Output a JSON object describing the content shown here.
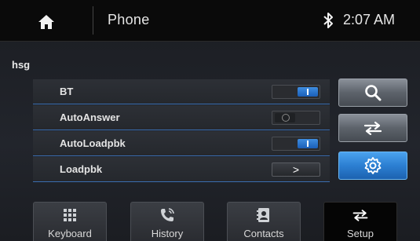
{
  "header": {
    "home_icon": "home-icon",
    "title": "Phone",
    "status_icon": "bluetooth-icon",
    "time": "2:07 AM"
  },
  "device": {
    "name": "hsg"
  },
  "settings": [
    {
      "label": "BT",
      "control": "toggle",
      "state": "on"
    },
    {
      "label": "AutoAnswer",
      "control": "toggle",
      "state": "off"
    },
    {
      "label": "AutoLoadpbk",
      "control": "toggle",
      "state": "on"
    },
    {
      "label": "Loadpbk",
      "control": "arrow",
      "arrow": ">"
    }
  ],
  "side_buttons": [
    {
      "icon": "search-icon"
    },
    {
      "icon": "swap-arrows-icon"
    },
    {
      "icon": "gear-icon",
      "active": true
    }
  ],
  "tabs": [
    {
      "label": "Keyboard",
      "icon": "keypad-icon"
    },
    {
      "label": "History",
      "icon": "phone-log-icon"
    },
    {
      "label": "Contacts",
      "icon": "contacts-card-icon"
    },
    {
      "label": "Setup",
      "icon": "swap-arrows-icon",
      "active": true
    }
  ],
  "colors": {
    "accent_blue": "#2c7fd2",
    "row_separator": "#3a6db0",
    "text": "#e4e4e4"
  }
}
